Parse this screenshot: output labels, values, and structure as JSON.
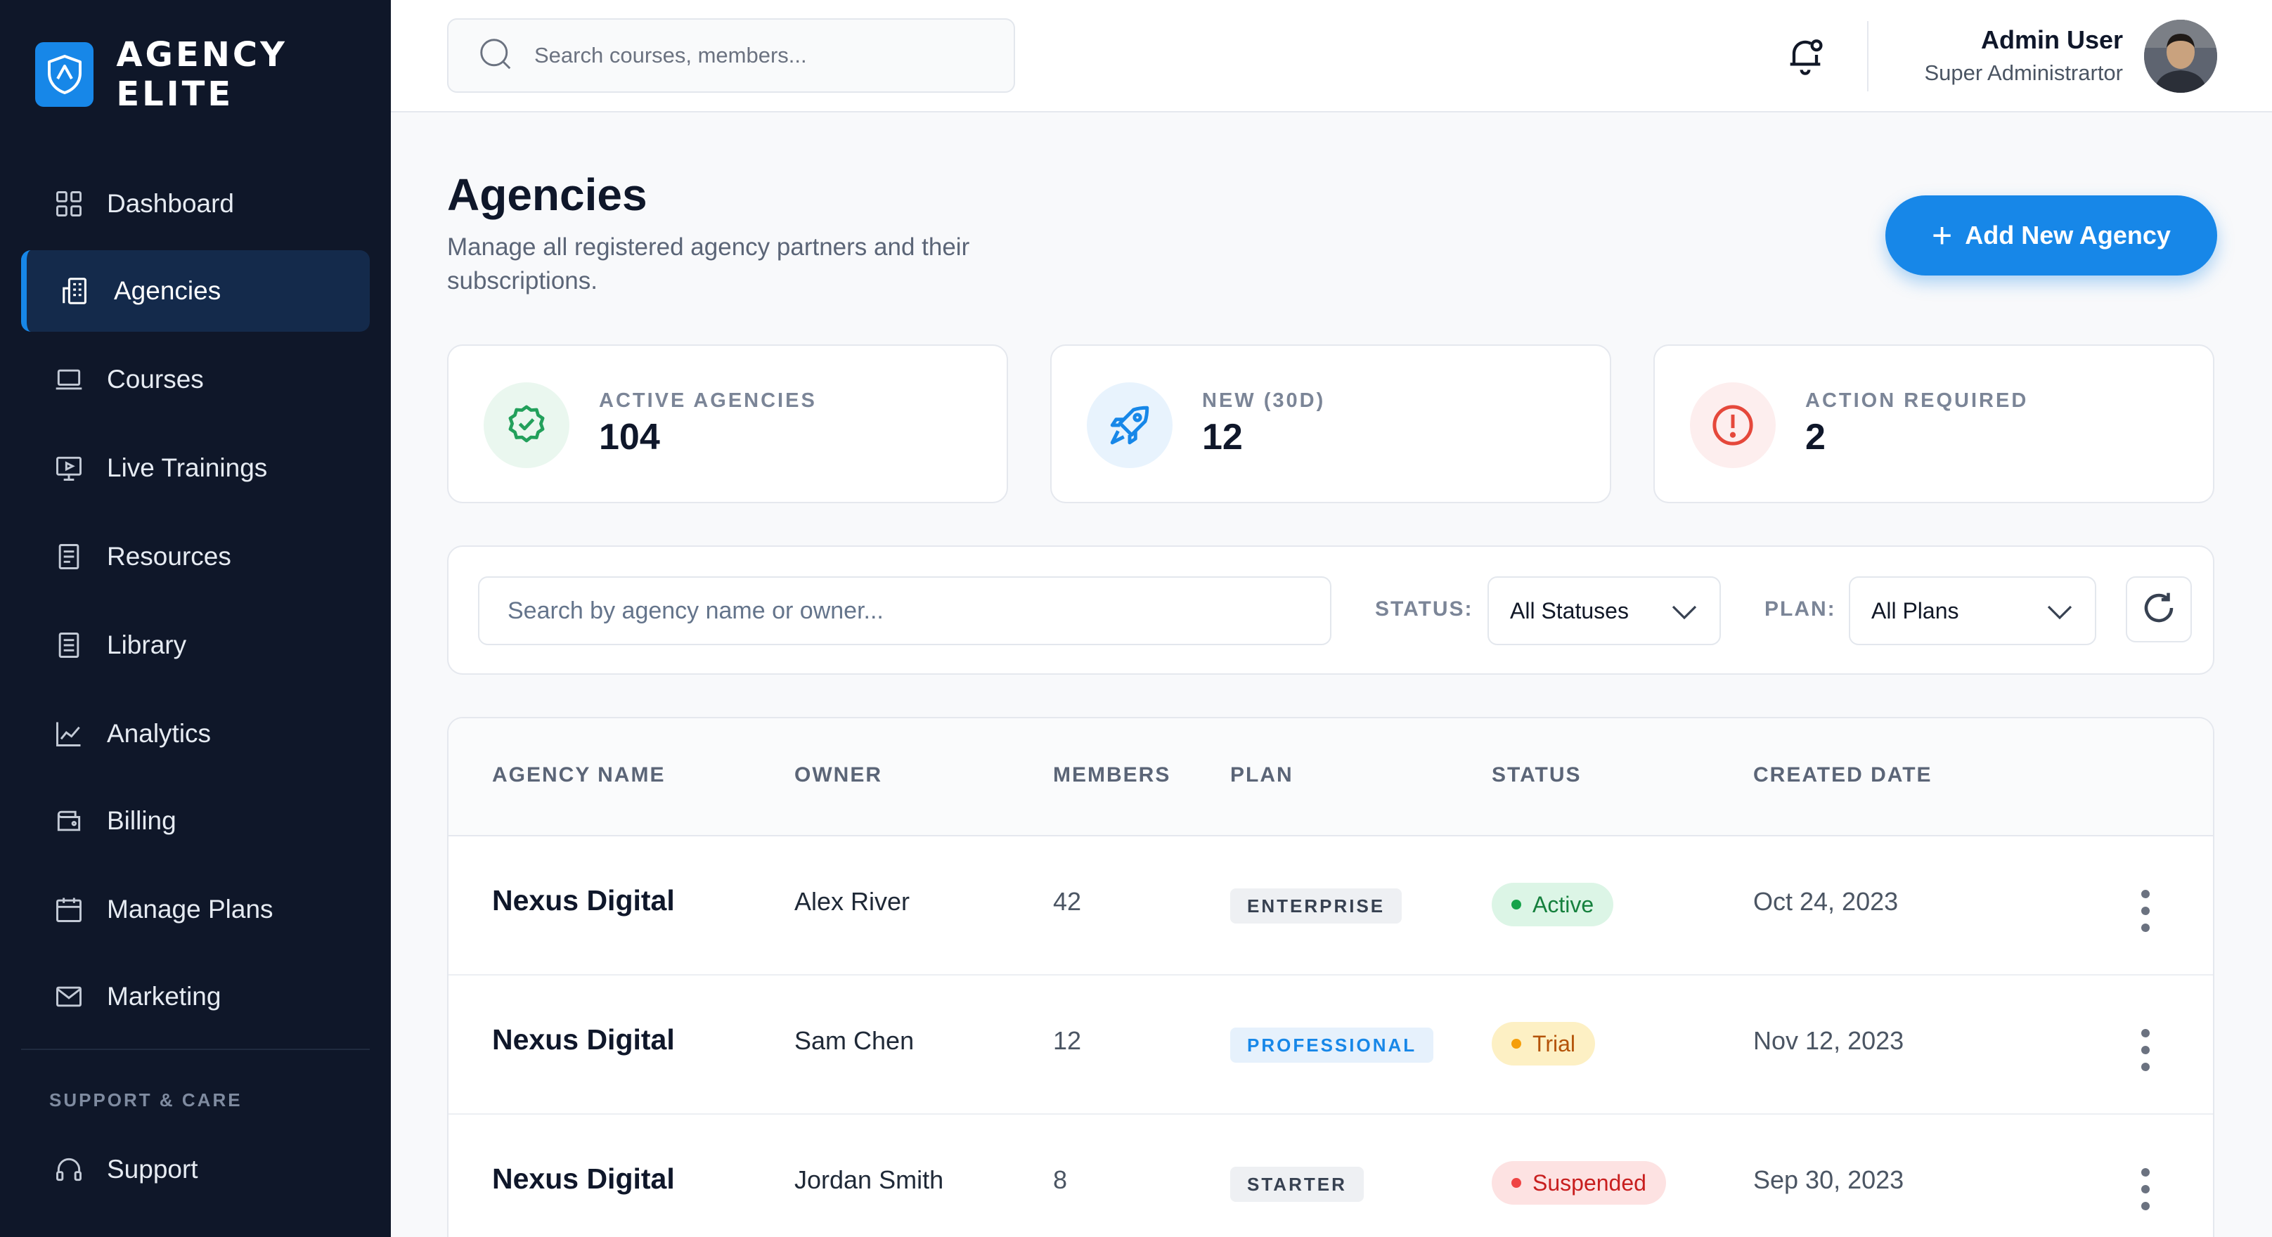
{
  "brand": {
    "name": "AGENCY ELITE",
    "icon": "shield-icon",
    "color": "#1787e8"
  },
  "sidebar": {
    "items": [
      {
        "label": "Dashboard",
        "icon": "grid-icon",
        "active": false
      },
      {
        "label": "Agencies",
        "icon": "building-icon",
        "active": true
      },
      {
        "label": "Courses",
        "icon": "laptop-icon",
        "active": false
      },
      {
        "label": "Live Trainings",
        "icon": "video-screen-icon",
        "active": false
      },
      {
        "label": "Resources",
        "icon": "document-icon",
        "active": false
      },
      {
        "label": "Library",
        "icon": "book-icon",
        "active": false
      },
      {
        "label": "Analytics",
        "icon": "chart-line-icon",
        "active": false
      },
      {
        "label": "Billing",
        "icon": "wallet-icon",
        "active": false
      },
      {
        "label": "Manage Plans",
        "icon": "calendar-icon",
        "active": false
      },
      {
        "label": "Marketing",
        "icon": "mail-icon",
        "active": false
      }
    ],
    "section_title": "SUPPORT & CARE",
    "support_items": [
      {
        "label": "Support",
        "icon": "headset-icon"
      }
    ]
  },
  "topbar": {
    "search_placeholder": "Search courses, members...",
    "user_name": "Admin User",
    "user_role": "Super Administrartor"
  },
  "header": {
    "title": "Agencies",
    "subtitle": "Manage all registered agency partners and their subscriptions.",
    "add_button": "Add New Agency"
  },
  "stats": [
    {
      "label": "ACTIVE AGENCIES",
      "value": "104",
      "icon": "badge-check-icon",
      "color": "#22a05b",
      "bg": "#eaf7ef"
    },
    {
      "label": "NEW (30D)",
      "value": "12",
      "icon": "rocket-icon",
      "color": "#1787e8",
      "bg": "#e8f3fd"
    },
    {
      "label": "ACTION REQUIRED",
      "value": "2",
      "icon": "alert-circle-icon",
      "color": "#e5483b",
      "bg": "#fdeeee"
    }
  ],
  "filters": {
    "search_placeholder": "Search by agency name or owner...",
    "status_label": "STATUS:",
    "status_value": "All Statuses",
    "plan_label": "PLAN:",
    "plan_value": "All Plans"
  },
  "table": {
    "columns": [
      "AGENCY NAME",
      "OWNER",
      "MEMBERS",
      "PLAN",
      "STATUS",
      "CREATED DATE"
    ],
    "rows": [
      {
        "name": "Nexus Digital",
        "owner": "Alex River",
        "members": "42",
        "plan": "ENTERPRISE",
        "status": "Active",
        "date": "Oct 24, 2023"
      },
      {
        "name": "Nexus Digital",
        "owner": "Sam Chen",
        "members": "12",
        "plan": "PROFESSIONAL",
        "status": "Trial",
        "date": "Nov 12, 2023"
      },
      {
        "name": "Nexus Digital",
        "owner": "Jordan Smith",
        "members": "8",
        "plan": "STARTER",
        "status": "Suspended",
        "date": "Sep 30, 2023"
      }
    ]
  },
  "colors": {
    "sidebar_bg": "#0f1729",
    "accent": "#1787e8",
    "active_green": "#16a34a",
    "trial_amber": "#d97706",
    "suspended_red": "#dc2626"
  }
}
